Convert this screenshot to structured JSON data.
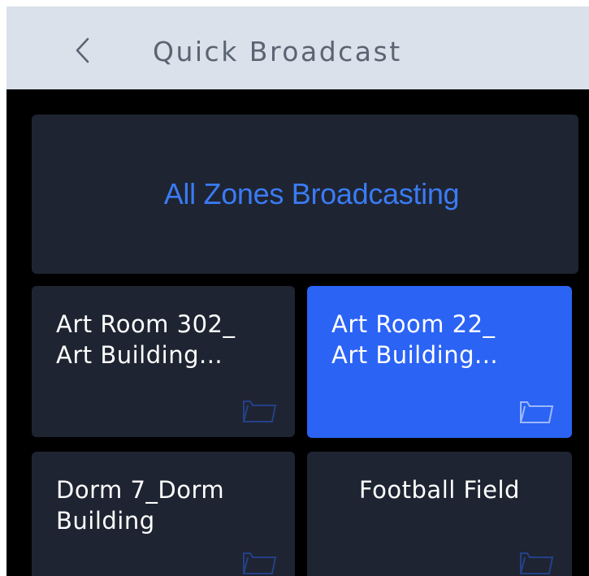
{
  "header": {
    "title": "Quick Broadcast",
    "back_icon": "chevron-left-icon"
  },
  "all_zones": {
    "label": "All Zones Broadcasting",
    "color": "#3a7bf5"
  },
  "zones": [
    {
      "label": "Art Room 302_\nArt Building...",
      "icon": "folder-icon",
      "selected": false
    },
    {
      "label": "Art Room 22_\nArt Building...",
      "icon": "folder-icon",
      "selected": true
    },
    {
      "label": "Dorm 7_Dorm\nBuilding",
      "icon": "folder-icon",
      "selected": false
    },
    {
      "label": "Football Field",
      "icon": "folder-icon",
      "selected": false
    }
  ],
  "colors": {
    "header_bg": "#dbe1ea",
    "content_bg": "#000000",
    "tile_bg": "#1e2431",
    "selected_bg": "#2b63f5",
    "folder_stroke": "#24408a"
  }
}
